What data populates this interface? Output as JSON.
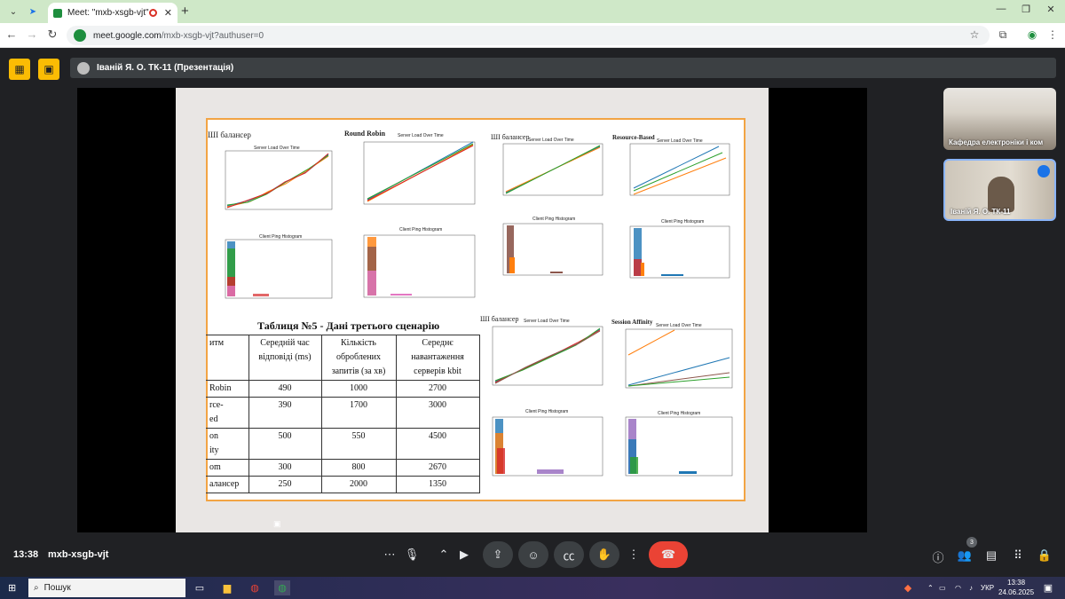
{
  "browser": {
    "tab_title": "Meet: \"mxb-xsgb-vjt\"",
    "url_host": "meet.google.com",
    "url_path": "/mxb-xsgb-vjt?authuser=0"
  },
  "meet": {
    "presenter_label": "Іваній Я. О. ТК-11 (Презентація)",
    "time": "13:38",
    "meeting_code": "mxb-xsgb-vjt",
    "participants_count": "3",
    "tiles": [
      {
        "name": "Кафедра електроніки і ком"
      },
      {
        "name": "Іваній Я. О. ТК-11"
      }
    ]
  },
  "slide": {
    "labels": {
      "ai1": "ШІ балансер",
      "rr": "Round Robin",
      "ai2": "ШІ балансер",
      "rb": "Resource-Based",
      "ai3": "ШІ балансер",
      "sa": "Session Affinity"
    },
    "chart_titles": {
      "load": "Server Load Over Time",
      "ping": "Client Ping Histogram"
    },
    "table": {
      "title": "Таблиця №5 -  Дані третього сценарію",
      "headers": [
        "итм",
        "Середній час відповіді (ms)",
        "Кількість оброблених запитів (за хв)",
        "Середнє навантаження серверів kbit"
      ],
      "rows": [
        [
          "Robin",
          "490",
          "1000",
          "2700"
        ],
        [
          "rce-\ned",
          "390",
          "1700",
          "3000"
        ],
        [
          "on\nity",
          "500",
          "550",
          "4500"
        ],
        [
          "om",
          "300",
          "800",
          "2670"
        ],
        [
          "алансер",
          "250",
          "2000",
          "1350"
        ]
      ]
    }
  },
  "taskbar": {
    "search_text": "Пошук",
    "lang": "УКР",
    "clock_time": "13:38",
    "clock_date": "24.06.2025"
  },
  "colors": {
    "meet_yellow": "#fbbc04",
    "hangup_red": "#ea4335",
    "slide_border": "#f2a444"
  }
}
